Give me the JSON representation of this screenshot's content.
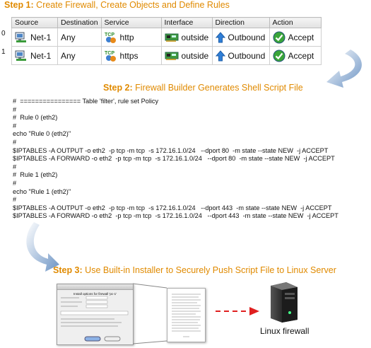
{
  "steps": {
    "step1": {
      "num": "Step 1:",
      "text": " Create Firewall, Create Objects and Define Rules"
    },
    "step2": {
      "num": "Step 2:",
      "text": " Firewall Builder Generates Shell Script File"
    },
    "step3": {
      "num": "Step 3:",
      "text": " Use Built-in Installer to Securely Push Script File to Linux Server"
    }
  },
  "rules_table": {
    "headers": [
      "Source",
      "Destination",
      "Service",
      "Interface",
      "Direction",
      "Action"
    ],
    "rows": [
      {
        "index": "0",
        "source": "Net-1",
        "destination": "Any",
        "service": "http",
        "interface": "outside",
        "direction": "Outbound",
        "action": "Accept"
      },
      {
        "index": "1",
        "source": "Net-1",
        "destination": "Any",
        "service": "https",
        "interface": "outside",
        "direction": "Outbound",
        "action": "Accept"
      }
    ],
    "service_icon_text": "TCP"
  },
  "script_text": "#  ================ Table 'filter', rule set Policy\n#\n#  Rule 0 (eth2)\n#\necho \"Rule 0 (eth2)\"\n#\n$IPTABLES -A OUTPUT -o eth2  -p tcp -m tcp  -s 172.16.1.0/24   --dport 80  -m state --state NEW  -j ACCEPT\n$IPTABLES -A FORWARD -o eth2  -p tcp -m tcp  -s 172.16.1.0/24   --dport 80  -m state --state NEW  -j ACCEPT\n#\n#  Rule 1 (eth2)\n#\necho \"Rule 1 (eth2)\"\n#\n$IPTABLES -A OUTPUT -o eth2  -p tcp -m tcp  -s 172.16.1.0/24   --dport 443  -m state --state NEW  -j ACCEPT\n$IPTABLES -A FORWARD -o eth2  -p tcp -m tcp  -s 172.16.1.0/24   --dport 443  -m state --state NEW  -j ACCEPT",
  "installer_dialog": {
    "title": "Install options for firewall 'pc-1'"
  },
  "linux_label": "Linux firewall",
  "colors": {
    "step_label": "#e08a00",
    "arrow_blue": "#6b93c4",
    "dashed_arrow": "#e02020",
    "accept_green": "#3aa53a",
    "direction_blue": "#2f7fd8"
  }
}
